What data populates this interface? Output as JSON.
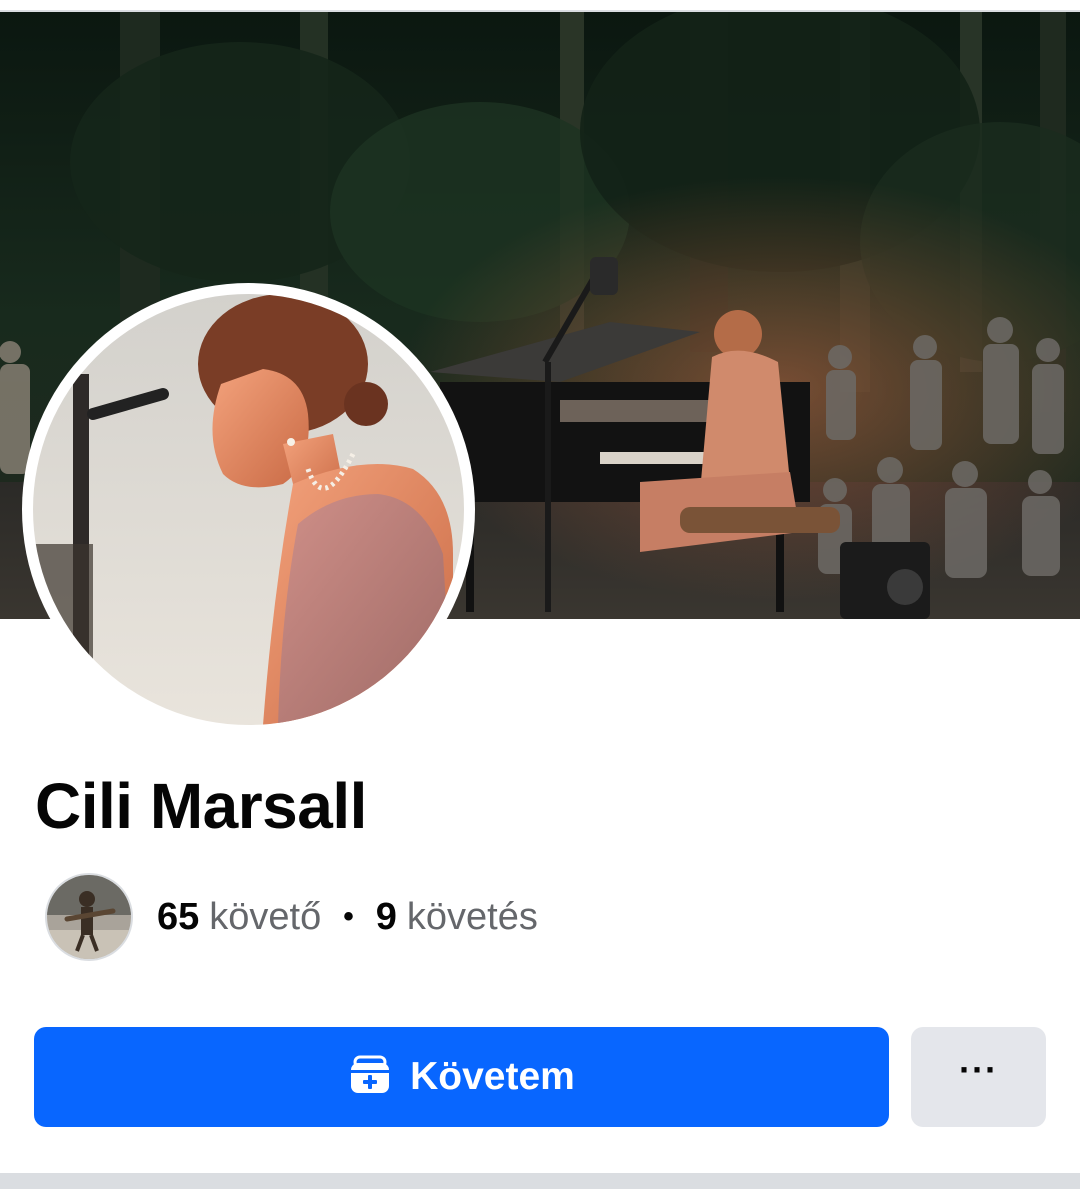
{
  "profile": {
    "name": "Cili Marsall"
  },
  "stats": {
    "followers_count": "65",
    "followers_label": "követő",
    "separator": "•",
    "following_count": "9",
    "following_label": "követés"
  },
  "actions": {
    "follow_label": "Követem",
    "follow_icon": "follow-briefcase-icon",
    "more_label": "···",
    "more_icon": "more-options-icon"
  },
  "colors": {
    "primary": "#0866ff",
    "secondary_button": "#e4e6eb",
    "text": "#050505",
    "muted_text": "#65676b"
  }
}
